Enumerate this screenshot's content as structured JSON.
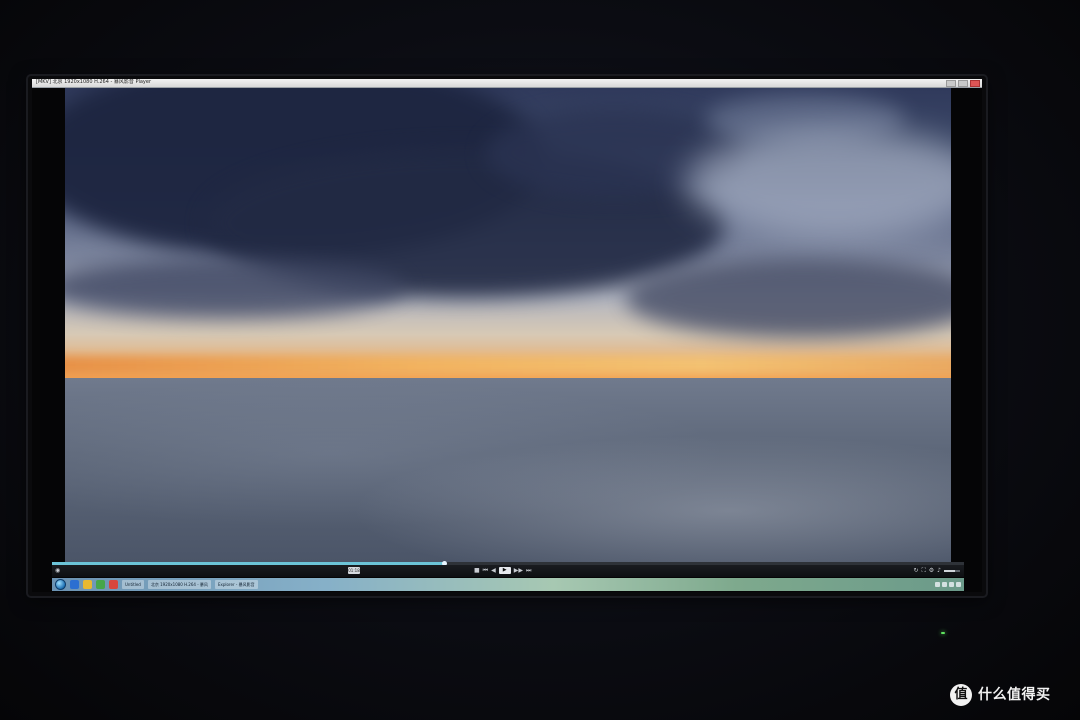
{
  "window": {
    "title": "[MKV] 北京 1920x1080 H.264 - 暴风影音 Player"
  },
  "player": {
    "progress_fraction": 0.43,
    "time_badge": "01:18",
    "volume_fraction": 0.7,
    "controls": {
      "left": [
        "menu-icon"
      ],
      "center": [
        "stop-icon",
        "prev-icon",
        "rewind-icon",
        "play-icon",
        "forward-icon",
        "next-icon",
        "eject-icon"
      ],
      "right": [
        "repeat-icon",
        "fullscreen-icon",
        "settings-icon",
        "volume-icon",
        "mute-icon"
      ]
    }
  },
  "taskbar": {
    "tasks": [
      "Untitled",
      "北京 1920x1080 H.264 - 暴风",
      "Explorer - 暴风影音"
    ]
  },
  "colors": {
    "progress_fill": "#6cc4d8",
    "power_led": "#5fe25f",
    "watermark": "#f2f2f2"
  },
  "watermark": {
    "logo_char": "值",
    "text": "什么值得买"
  }
}
